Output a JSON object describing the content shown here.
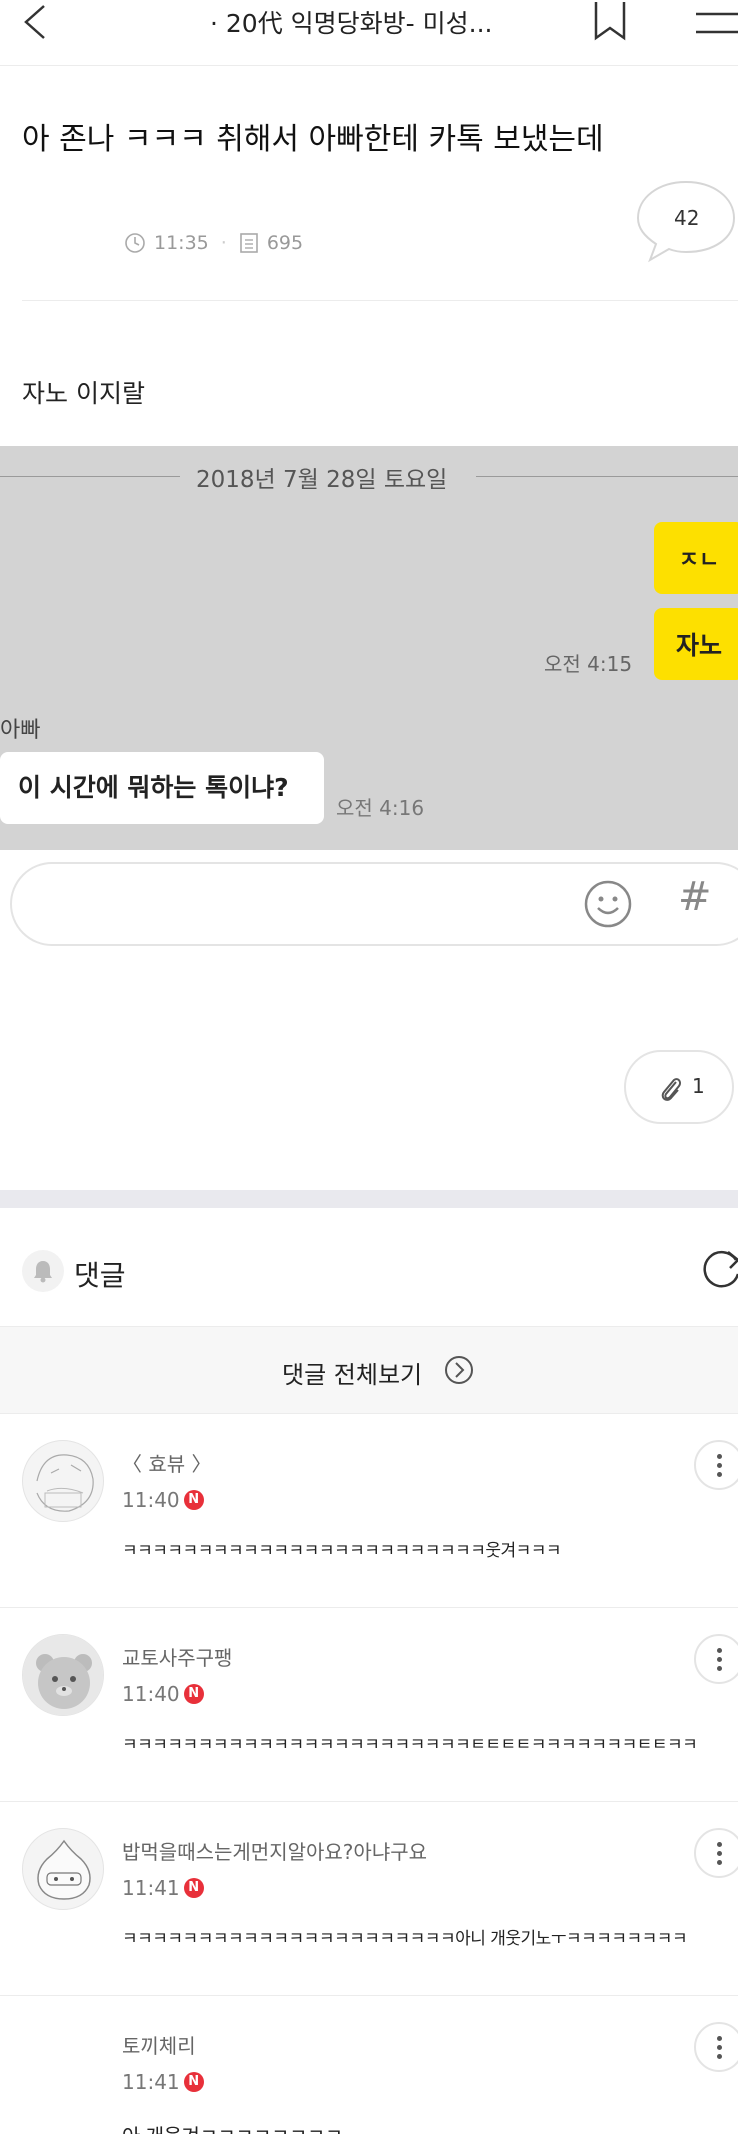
{
  "header": {
    "room_title": "· 20代 익명당화방- 미성..."
  },
  "post": {
    "title": "아 존나 ㅋㅋㅋ 취해서 아빠한테 카톡 보냈는데",
    "time": "11:35",
    "views": "695",
    "comment_count": "42",
    "body": "자노 이지랄"
  },
  "chat": {
    "date": "2018년 7월 28일 토요일",
    "my_messages": [
      "ㅈㄴ",
      "자노"
    ],
    "my_time": "오전 4:15",
    "sender_name": "아빠",
    "reply": "이 시간에 뭐하는 톡이냐?",
    "reply_time": "오전 4:16"
  },
  "attachments": {
    "count": "1"
  },
  "comments_section": {
    "label": "댓글",
    "view_all": "댓글 전체보기"
  },
  "comments": [
    {
      "nickname": "〈 효뷰 〉",
      "time": "11:40",
      "badge": "N",
      "text": "ㅋㅋㅋㅋㅋㅋㅋㅋㅋㅋㅋㅋㅋㅋㅋㅋㅋㅋㅋㅋㅋㅋㅋㅋ웃겨ㅋㅋㅋ"
    },
    {
      "nickname": "교토사주구팽",
      "time": "11:40",
      "badge": "N",
      "text": "ㅋㅋㅋㅋㅋㅋㅋㅋㅋㅋㅋㅋㅋㅋㅋㅋㅋㅋㅋㅋㅋㅋㅋㅌㅌㅌㅌㅋㅋㅋㅋㅋㅋㅋㅌㅌㅋㅋ"
    },
    {
      "nickname": "밥먹을때스는게먼지알아요?아냐구요",
      "time": "11:41",
      "badge": "N",
      "text": "ㅋㅋㅋㅋㅋㅋㅋㅋㅋㅋㅋㅋㅋㅋㅋㅋㅋㅋㅋㅋㅋㅋ아니 개웃기노ㅜㅋㅋㅋㅋㅋㅋㅋㅋ"
    },
    {
      "nickname": "토끼체리",
      "time": "11:41",
      "badge": "N",
      "text": "아 개웃겨ㅋㅋㅋㅋㅋㅋㅋㅋ"
    }
  ]
}
